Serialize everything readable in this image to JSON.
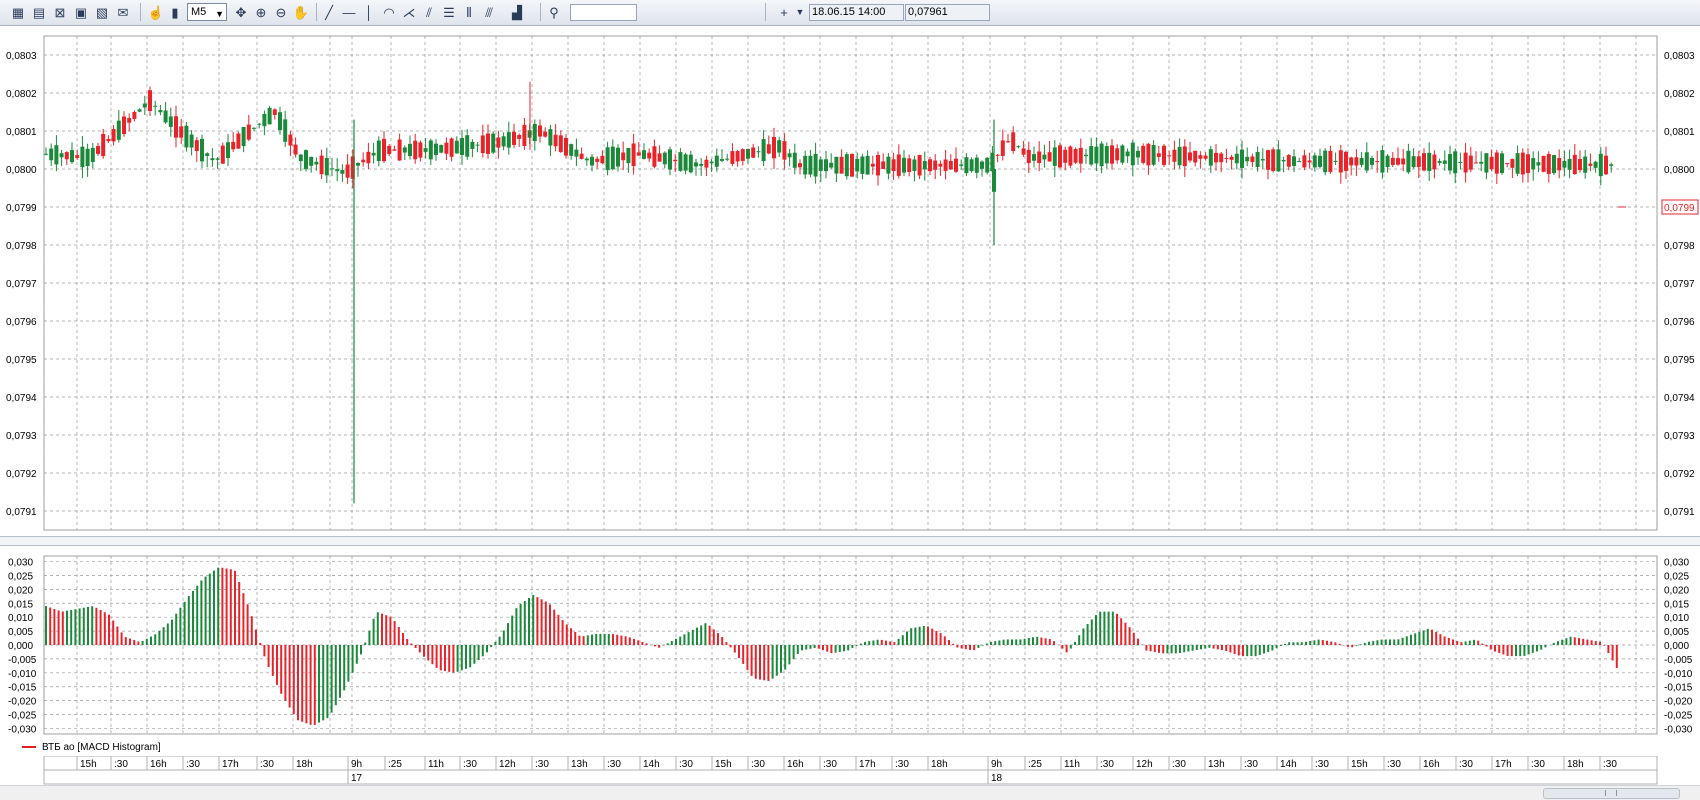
{
  "toolbar": {
    "timeframe": "M5",
    "search_value": "",
    "date_value": "18.06.15 14:00",
    "price_value": "0,07961",
    "icons": [
      "chart-window-icon",
      "open-icon",
      "delete-icon",
      "template-icon",
      "print-icon",
      "mail-icon",
      "cursor-hand-icon",
      "candle-type-icon",
      "timeframe-dropdown",
      "move-icon",
      "zoom-in-icon",
      "zoom-out-icon",
      "pan-hand-icon",
      "trend-line-icon",
      "horizontal-line-icon",
      "vertical-line-icon",
      "arc-icon",
      "fan-icon",
      "channel-icon",
      "levels-icon",
      "vertical-lines-icon",
      "parallel-icon",
      "indicators-icon",
      "search-icon",
      "crosshair-icon",
      "dropdown-icon"
    ]
  },
  "main_chart": {
    "y_axis_labels": [
      "0,0803",
      "0,0802",
      "0,0801",
      "0,0800",
      "0,0799",
      "0,0798",
      "0,0797",
      "0,0796",
      "0,0795",
      "0,0794",
      "0,0793",
      "0,0792",
      "0,0791"
    ],
    "current_price_label": "0,0799",
    "ylim": [
      0.07905,
      0.08035
    ]
  },
  "indicator": {
    "legend": "ВТБ ао [MACD Histogram]",
    "y_axis_labels": [
      "0,030",
      "0,025",
      "0,020",
      "0,015",
      "0,010",
      "0,005",
      "0,000",
      "-0,005",
      "-0,010",
      "-0,015",
      "-0,020",
      "-0,025",
      "-0,030"
    ]
  },
  "time_axis": {
    "ticks": [
      "15h",
      ":30",
      "16h",
      ":30",
      "17h",
      ":30",
      "18h",
      "9h",
      ":25",
      "11h",
      ":30",
      "12h",
      ":30",
      "13h",
      ":30",
      "14h",
      ":30",
      "15h",
      ":30",
      "16h",
      ":30",
      "17h",
      ":30",
      "18h",
      "9h",
      ":25",
      "11h",
      ":30",
      "12h",
      ":30",
      "13h",
      ":30",
      "14h",
      ":30",
      "15h",
      ":30",
      "16h",
      ":30",
      "17h",
      ":30",
      "18h",
      ":30"
    ],
    "days": [
      "17",
      "18"
    ]
  },
  "colors": {
    "up": "#1a8a3a",
    "down": "#e8232a",
    "grid": "#9a9a9a",
    "price_tag": "#e8232a"
  },
  "chart_data": {
    "type": "candlestick",
    "instrument": "ВТБ ао",
    "timeframe": "M5",
    "price_range": [
      0.0791,
      0.0803
    ],
    "notable_lows": [
      0.07912,
      0.0798
    ],
    "notable_highs": [
      0.08023,
      0.08014
    ],
    "last_price": 0.0799,
    "macd_histogram_range": [
      -0.029,
      0.028
    ],
    "macd_histogram_samples": [
      0.014,
      0.012,
      0.013,
      0.014,
      0.011,
      0.003,
      0.001,
      0.004,
      0.009,
      0.017,
      0.024,
      0.028,
      0.027,
      0.012,
      -0.006,
      -0.018,
      -0.027,
      -0.029,
      -0.026,
      -0.016,
      -0.004,
      0.012,
      0.01,
      0.002,
      -0.004,
      -0.009,
      -0.01,
      -0.008,
      -0.003,
      0.004,
      0.014,
      0.018,
      0.015,
      0.008,
      0.003,
      0.004,
      0.004,
      0.003,
      0.001,
      -0.001,
      0.002,
      0.005,
      0.008,
      0.003,
      -0.004,
      -0.012,
      -0.013,
      -0.009,
      -0.002,
      -0.001,
      -0.003,
      -0.002,
      0.001,
      0.002,
      0.001,
      0.006,
      0.007,
      0.004,
      -0.001,
      -0.002,
      0.001,
      0.002,
      0.002,
      0.003,
      0.002,
      -0.003,
      0.006,
      0.012,
      0.012,
      0.006,
      -0.002,
      -0.003,
      -0.003,
      -0.002,
      -0.001,
      -0.002,
      -0.004,
      -0.004,
      -0.002,
      0.001,
      0.001,
      0.002,
      0.001,
      -0.001,
      0.001,
      0.002,
      0.002,
      0.004,
      0.006,
      0.003,
      0.001,
      0.002,
      -0.002,
      -0.004,
      -0.004,
      -0.002,
      0.001,
      0.003,
      0.002,
      0.001,
      -0.009
    ]
  }
}
